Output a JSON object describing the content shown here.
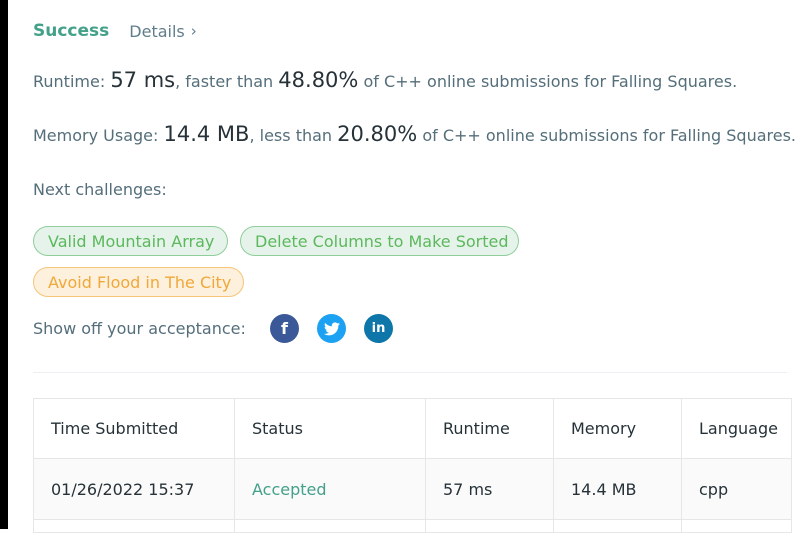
{
  "header": {
    "status": "Success",
    "details_link": "Details",
    "chevron": "›"
  },
  "runtime": {
    "label": "Runtime:",
    "value": "57 ms",
    "comparison": ", faster than",
    "percent": "48.80%",
    "suffix": "of C++ online submissions for Falling Squares."
  },
  "memory": {
    "label": "Memory Usage:",
    "value": "14.4 MB",
    "comparison": ", less than",
    "percent": "20.80%",
    "suffix": "of C++ online submissions for Falling Squares."
  },
  "next_challenges": {
    "label": "Next challenges:",
    "items": [
      {
        "title": "Valid Mountain Array",
        "difficulty_color": "#5cb85c"
      },
      {
        "title": "Delete Columns to Make Sorted",
        "difficulty_color": "#5cb85c"
      },
      {
        "title": "Avoid Flood in The City",
        "difficulty_color": "#f0a83a"
      }
    ]
  },
  "share": {
    "label": "Show off your acceptance:",
    "icons": [
      {
        "name": "facebook-icon",
        "glyph": "f",
        "color": "#3b5998"
      },
      {
        "name": "twitter-icon",
        "glyph": "t",
        "color": "#1da1f2"
      },
      {
        "name": "linkedin-icon",
        "glyph": "in",
        "color": "#0e76a8"
      }
    ]
  },
  "table": {
    "headers": [
      "Time Submitted",
      "Status",
      "Runtime",
      "Memory",
      "Language"
    ],
    "rows": [
      [
        "01/26/2022 15:37",
        "Accepted",
        "57 ms",
        "14.4 MB",
        "cpp"
      ]
    ]
  },
  "colors": {
    "accent": "#43a089",
    "easy": "#5cb85c",
    "medium": "#f0a83a"
  }
}
